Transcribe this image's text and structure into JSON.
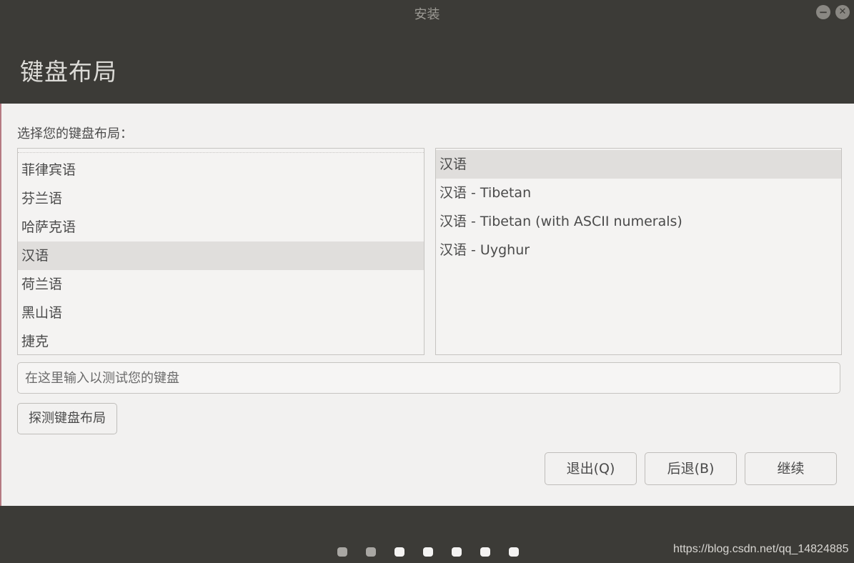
{
  "window": {
    "title": "安装",
    "minimize_glyph": "−",
    "close_glyph": "✕"
  },
  "header": {
    "title": "键盘布局"
  },
  "main": {
    "prompt": "选择您的键盘布局：",
    "layout_list": {
      "items": [
        "菲律宾语",
        "芬兰语",
        "哈萨克语",
        "汉语",
        "荷兰语",
        "黑山语",
        "捷克"
      ],
      "selected_index": 3
    },
    "variant_list": {
      "items": [
        "汉语",
        "汉语 - Tibetan",
        "汉语 - Tibetan (with ASCII numerals)",
        "汉语 - Uyghur"
      ],
      "selected_index": 0
    },
    "test_input": {
      "placeholder": "在这里输入以测试您的键盘",
      "value": ""
    },
    "detect_button": "探测键盘布局"
  },
  "actions": {
    "quit": "退出(Q)",
    "back": "后退(B)",
    "continue": "继续"
  },
  "footer": {
    "progress_total_steps": 7,
    "progress_completed_steps": 2,
    "watermark": "https://blog.csdn.net/qq_14824885"
  },
  "colors": {
    "chrome_dark": "#3c3b37",
    "content_bg": "#f2f1f0",
    "selection_bg": "#e0dedc"
  }
}
